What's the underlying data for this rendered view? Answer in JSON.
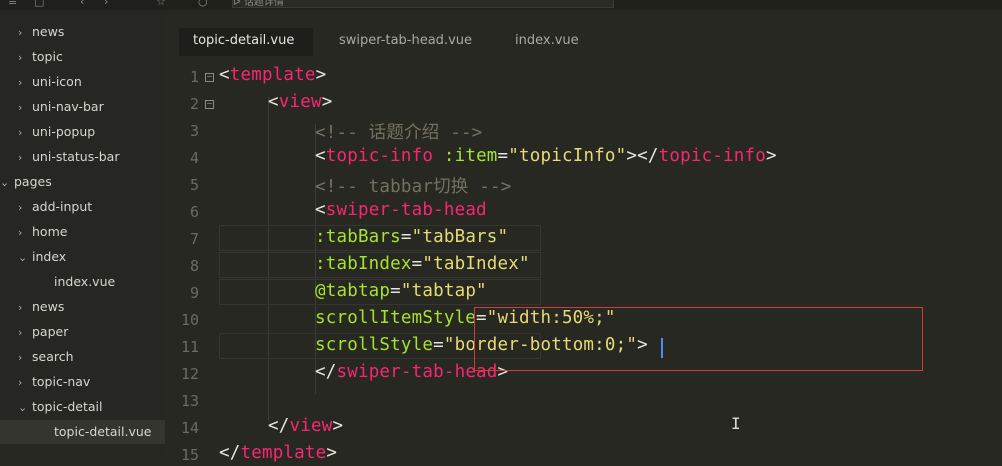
{
  "toolbar": {
    "address_text": "ᐅ 话题详情"
  },
  "sidebar": {
    "items": [
      {
        "label": "news",
        "chev": "›",
        "depth": 1
      },
      {
        "label": "topic",
        "chev": "›",
        "depth": 1
      },
      {
        "label": "uni-icon",
        "chev": "›",
        "depth": 1
      },
      {
        "label": "uni-nav-bar",
        "chev": "›",
        "depth": 1
      },
      {
        "label": "uni-popup",
        "chev": "›",
        "depth": 1
      },
      {
        "label": "uni-status-bar",
        "chev": "›",
        "depth": 1
      },
      {
        "label": "pages",
        "chev": "⌄",
        "depth": 0
      },
      {
        "label": "add-input",
        "chev": "›",
        "depth": 1
      },
      {
        "label": "home",
        "chev": "›",
        "depth": 1
      },
      {
        "label": "index",
        "chev": "⌄",
        "depth": 1
      },
      {
        "label": "index.vue",
        "chev": "",
        "depth": 2
      },
      {
        "label": "news",
        "chev": "›",
        "depth": 1
      },
      {
        "label": "paper",
        "chev": "›",
        "depth": 1
      },
      {
        "label": "search",
        "chev": "›",
        "depth": 1
      },
      {
        "label": "topic-nav",
        "chev": "›",
        "depth": 1
      },
      {
        "label": "topic-detail",
        "chev": "⌄",
        "depth": 1
      },
      {
        "label": "topic-detail.vue",
        "chev": "",
        "depth": 2,
        "selected": true
      }
    ]
  },
  "tabs": [
    {
      "label": "topic-detail.vue",
      "active": true
    },
    {
      "label": "swiper-tab-head.vue",
      "active": false
    },
    {
      "label": "index.vue",
      "active": false
    }
  ],
  "code": {
    "line_numbers": [
      "1",
      "2",
      "3",
      "4",
      "5",
      "6",
      "7",
      "8",
      "9",
      "10",
      "11",
      "12",
      "13",
      "14",
      "15"
    ],
    "lines": [
      [
        [
          "c-bracket",
          "<"
        ],
        [
          "c-tag",
          "template"
        ],
        [
          "c-bracket",
          ">"
        ]
      ],
      [
        [
          "c-bracket",
          "<"
        ],
        [
          "c-tag",
          "view"
        ],
        [
          "c-bracket",
          ">"
        ]
      ],
      [
        [
          "c-comment",
          "<!-- 话题介绍 -->"
        ]
      ],
      [
        [
          "c-bracket",
          "<"
        ],
        [
          "c-tag",
          "topic-info"
        ],
        [
          "c-plain",
          " "
        ],
        [
          "c-attr",
          ":item"
        ],
        [
          "c-eq",
          "="
        ],
        [
          "c-str",
          "\"topicInfo\""
        ],
        [
          "c-bracket",
          "></"
        ],
        [
          "c-tag",
          "topic-info"
        ],
        [
          "c-bracket",
          ">"
        ]
      ],
      [
        [
          "c-comment",
          "<!-- tabbar切换 -->"
        ]
      ],
      [
        [
          "c-bracket",
          "<"
        ],
        [
          "c-tag",
          "swiper-tab-head"
        ]
      ],
      [
        [
          "c-attr",
          ":tabBars"
        ],
        [
          "c-eq",
          "="
        ],
        [
          "c-str",
          "\"tabBars\""
        ]
      ],
      [
        [
          "c-attr",
          ":tabIndex"
        ],
        [
          "c-eq",
          "="
        ],
        [
          "c-str",
          "\"tabIndex\""
        ]
      ],
      [
        [
          "c-attr",
          "@tabtap"
        ],
        [
          "c-eq",
          "="
        ],
        [
          "c-str",
          "\"tabtap\""
        ]
      ],
      [
        [
          "c-attr",
          "scrollItemStyle"
        ],
        [
          "c-eq",
          "="
        ],
        [
          "c-str",
          "\"width:50%;\""
        ]
      ],
      [
        [
          "c-attr",
          "scrollStyle"
        ],
        [
          "c-eq",
          "="
        ],
        [
          "c-str",
          "\"border-bottom:0;\""
        ],
        [
          "c-bracket",
          ">"
        ]
      ],
      [
        [
          "c-bracket",
          "</"
        ],
        [
          "c-tag",
          "swiper-tab-head"
        ],
        [
          "c-bracket",
          ">"
        ]
      ],
      [],
      [
        [
          "c-bracket",
          "</"
        ],
        [
          "c-tag",
          "view"
        ],
        [
          "c-bracket",
          ">"
        ]
      ],
      [
        [
          "c-bracket",
          "</"
        ],
        [
          "c-tag",
          "template"
        ],
        [
          "c-bracket",
          ">"
        ]
      ]
    ]
  },
  "colors": {
    "background": "#272822",
    "tag": "#f92672",
    "attr": "#a6e22e",
    "string": "#e6db74",
    "comment": "#75715e",
    "highlight_box": "#d23c3c",
    "cursor": "#4d8cf0"
  }
}
